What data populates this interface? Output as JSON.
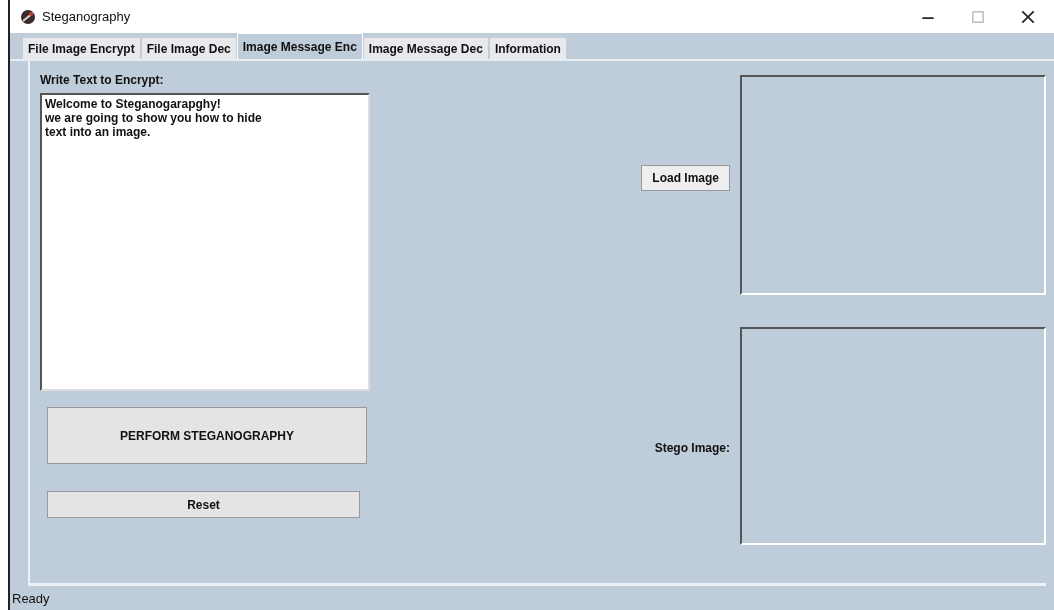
{
  "window": {
    "title": "Steganography"
  },
  "tabs": [
    {
      "label": "File Image Encrypt",
      "selected": false
    },
    {
      "label": "File Image Dec",
      "selected": false
    },
    {
      "label": "Image Message Enc",
      "selected": true
    },
    {
      "label": "Image Message Dec",
      "selected": false
    },
    {
      "label": "Information",
      "selected": false
    }
  ],
  "message": {
    "label": "Write Text to Encrypt:",
    "value": "Welcome to Steganogarapghy!\nwe are going to show you how to hide\ntext into an image."
  },
  "buttons": {
    "perform": "PERFORM STEGANOGRAPHY",
    "reset": "Reset",
    "load": "Load Image"
  },
  "stego_label": "Stego Image:",
  "status_bar": "Ready"
}
